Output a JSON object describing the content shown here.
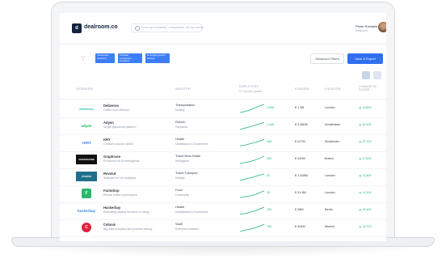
{
  "header": {
    "logo_mark": "d",
    "logo_text": "dealroom.co",
    "search_placeholder": "Look up investors, companies, etc by name",
    "user_name": "Pieter Roelants",
    "user_role": "Dealroom"
  },
  "filters": {
    "chips": [
      "Investment Unicorns",
      "Portfolio companies Investors",
      "Emerging growth Europe"
    ],
    "advanced_label": "Advanced Filters",
    "save_label": "Save & Export"
  },
  "table": {
    "columns": [
      "Overview",
      "Industry",
      "Employees",
      "Funding",
      "Location",
      "Change in score"
    ],
    "columns_sub": [
      "",
      "",
      "12 months growth",
      "",
      "",
      ""
    ],
    "rows": [
      {
        "name": "Deliveroo",
        "desc": "Online food delivery",
        "industry": "Transportation",
        "sub": "Mobility",
        "employees": "2,559",
        "funding": "€ 1.3B",
        "location": "London",
        "change": "▲ 19,800",
        "logo": "deliveroo",
        "color": "#1cbfa6"
      },
      {
        "name": "Adyen",
        "desc": "Single payments platform",
        "industry": "Fintech",
        "sub": "Payments",
        "employees": "1,168",
        "funding": "€ 2,850M",
        "location": "Amsterdam",
        "change": "▲ 40,100",
        "logo": "adyen",
        "color": "#0abf53"
      },
      {
        "name": "KRY",
        "desc": "Consult a doctor online",
        "industry": "Health",
        "sub": "Marketplace & Ecommerce",
        "employees": "948",
        "funding": "€ 227M",
        "location": "Stockholm",
        "change": "▲ 20,700",
        "logo": "+KRY",
        "color": "#2d7be5"
      },
      {
        "name": "Graphcore",
        "desc": "Processor for AI intelligence",
        "industry": "Travel Real Estate",
        "sub": "Workspace",
        "employees": "330",
        "funding": "€ 410M",
        "location": "Bristol",
        "change": "▲ 17,500",
        "logo": "GRAPHCORE",
        "color": "#111111"
      },
      {
        "name": "Revolut",
        "desc": "Software for UX analytics",
        "industry": "Travel Transport",
        "sub": "Mobility",
        "employees": "53",
        "funding": "€ 1,528M",
        "location": "London",
        "change": "▲ 22,800",
        "logo": "revolut",
        "color": "#1f6f8b"
      },
      {
        "name": "Farmdrop",
        "desc": "Ethical online supermarket",
        "industry": "Food",
        "sub": "Community",
        "employees": "40",
        "funding": "€ 31.5M",
        "location": "London",
        "change": "▲ 12,100",
        "logo": "F",
        "color": "#2cb86a"
      },
      {
        "name": "Hackerbay",
        "desc": "Recruiting startup focused on hiring",
        "industry": "Health",
        "sub": "Marketplace & Ecommerce",
        "employees": "109",
        "funding": "€ 28M",
        "location": "Berlin",
        "change": "▲ 18,400",
        "logo": "hackerbay",
        "color": "#2e8ad8"
      },
      {
        "name": "Celonis",
        "desc": "Big data analytics and process mining",
        "industry": "SaaS",
        "sub": "Enterprise software",
        "employees": "763",
        "funding": "€ 324M",
        "location": "Munich",
        "change": "▲ 30,700",
        "logo": "C",
        "color": "#e2213b"
      }
    ]
  },
  "colors": {
    "accent": "#2f6ff0",
    "chip": "#3d7df5",
    "positive": "#22b37a",
    "brand": "#12233f"
  },
  "icons": [
    "logo-icon",
    "search-icon",
    "avatar",
    "filter-icon",
    "grid-view-icon",
    "list-view-icon"
  ]
}
